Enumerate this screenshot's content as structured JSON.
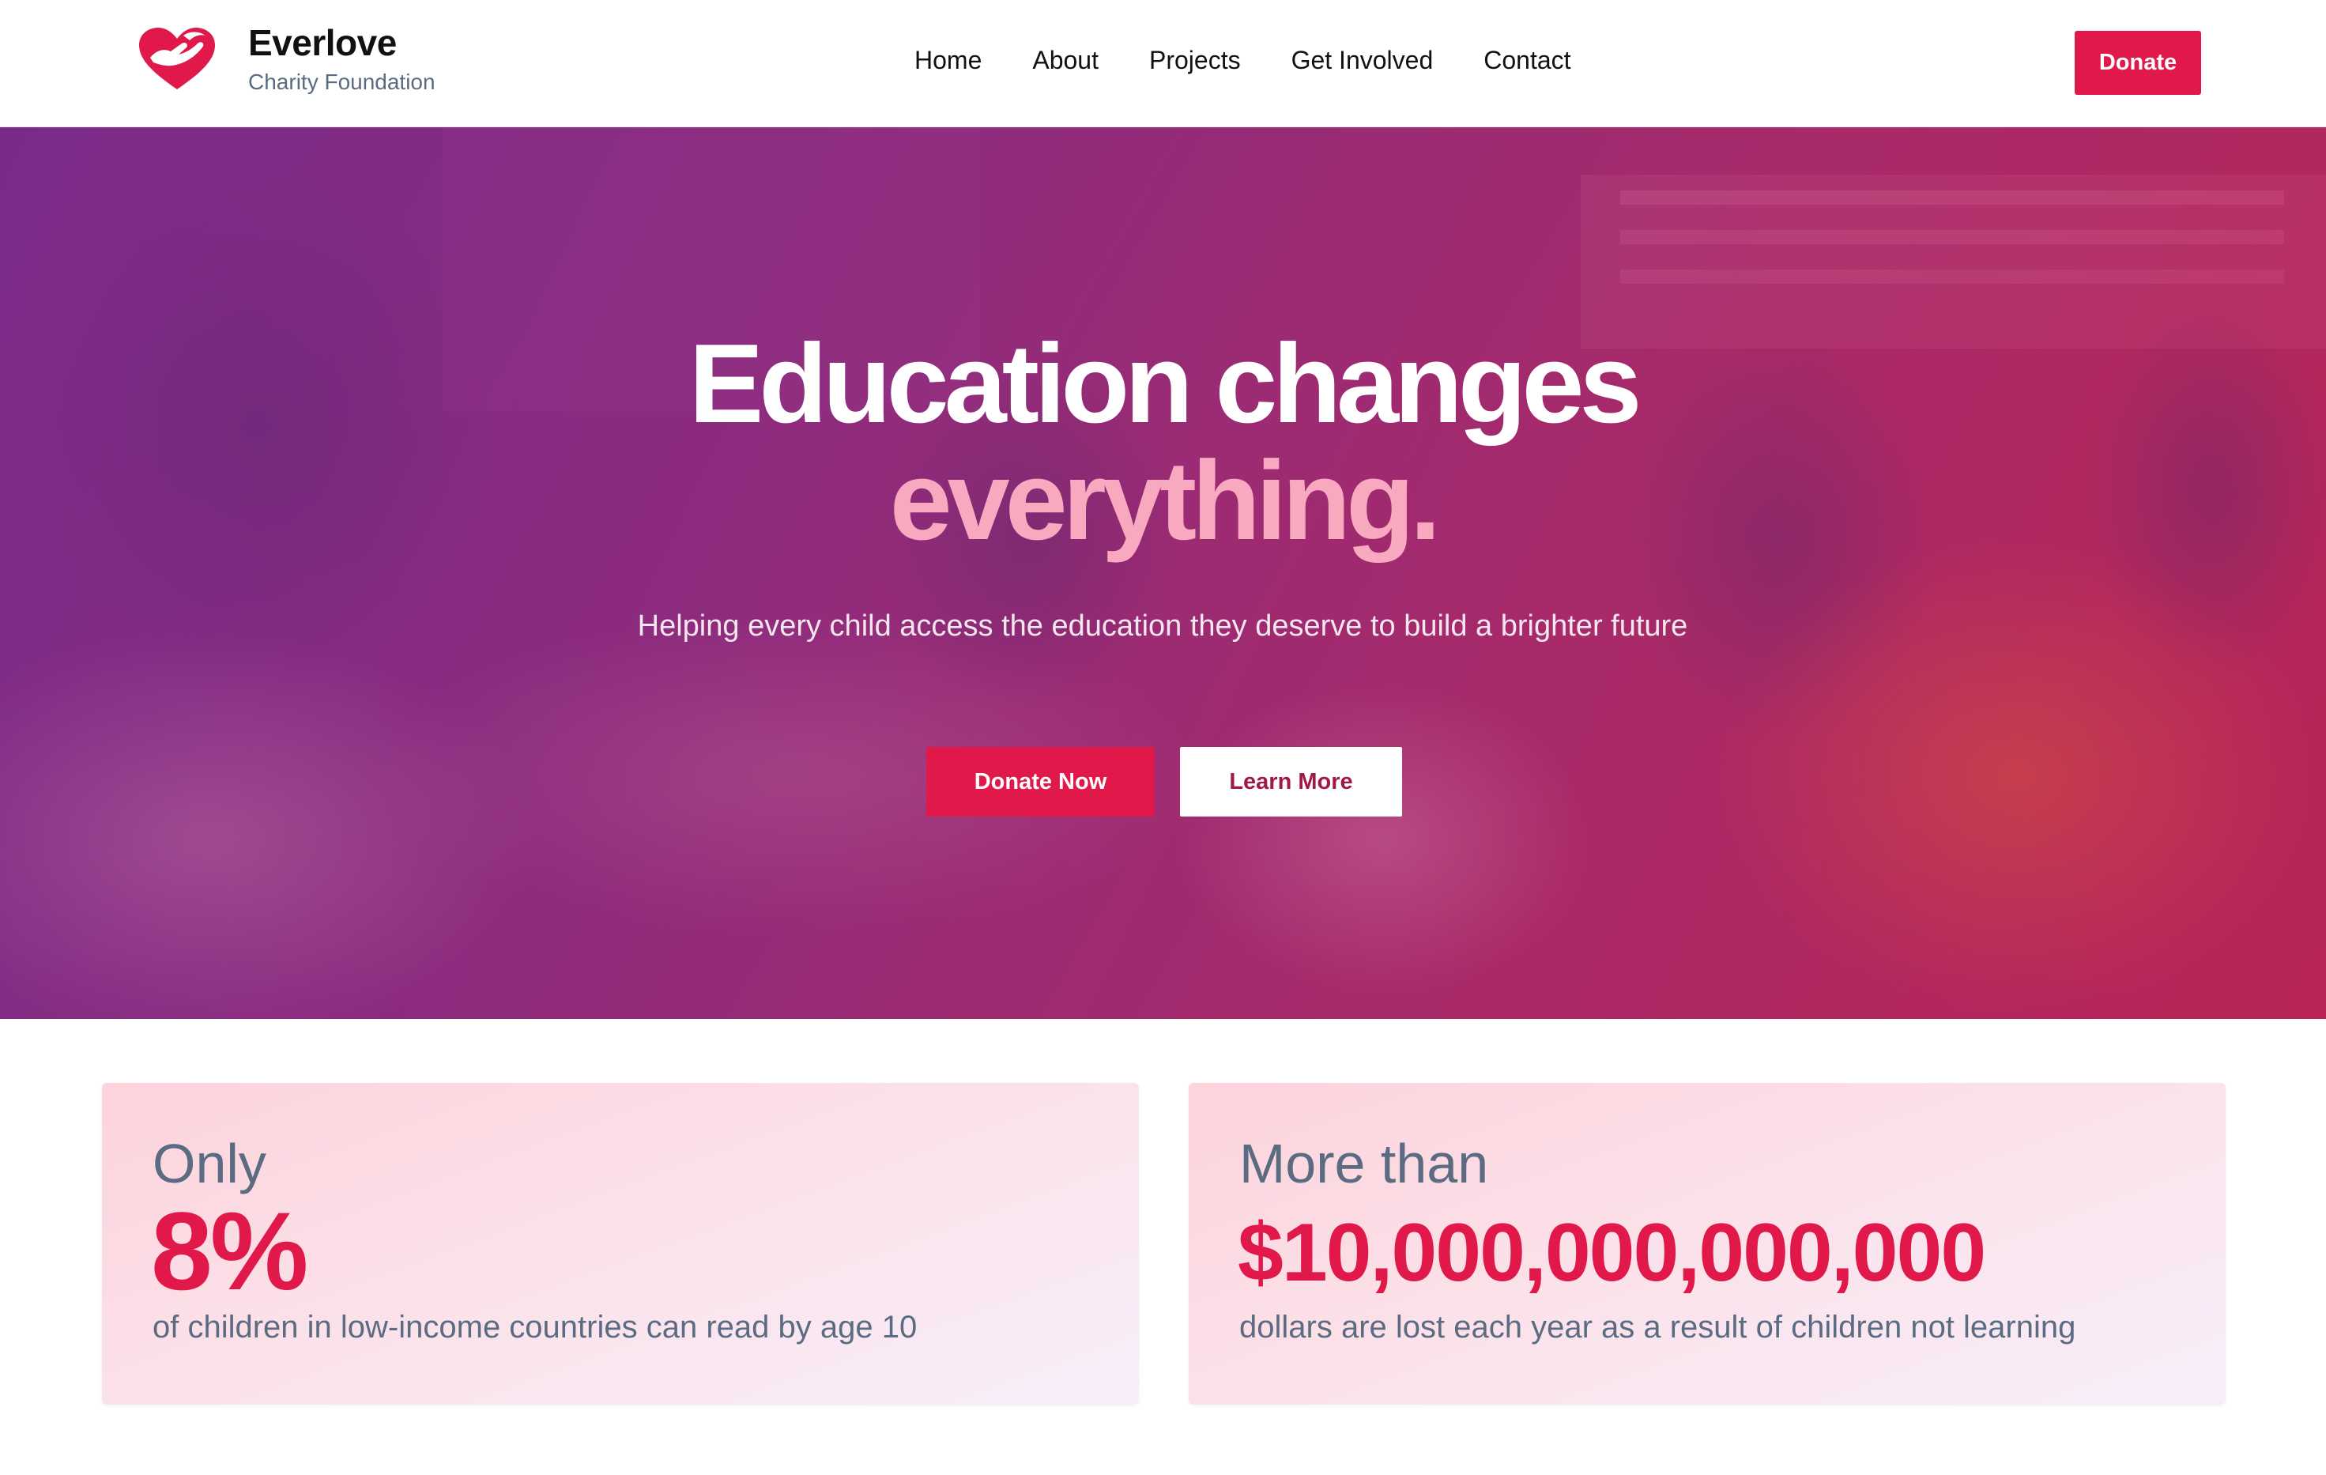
{
  "brand": {
    "name": "Everlove",
    "tagline": "Charity Foundation",
    "logo_icon": "heart-hands-icon",
    "color": "#e0194a"
  },
  "nav": {
    "links": [
      "Home",
      "About",
      "Projects",
      "Get Involved",
      "Contact"
    ],
    "donate_label": "Donate"
  },
  "hero": {
    "title": "Education changes",
    "title_accent": "everything.",
    "subtitle": "Helping every child access the education they deserve to build a brighter future",
    "primary_button": "Donate Now",
    "secondary_button": "Learn More"
  },
  "stats": [
    {
      "lead": "Only",
      "value": "8%",
      "description": "of children in low-income countries can read by age 10"
    },
    {
      "lead": "More than",
      "value": "$10,000,000,000,000",
      "description": "dollars are lost each year as a result of children not learning"
    }
  ],
  "colors": {
    "accent": "#e0194a",
    "accent_light": "#f8a9bf",
    "muted_text": "#5b6b82"
  }
}
